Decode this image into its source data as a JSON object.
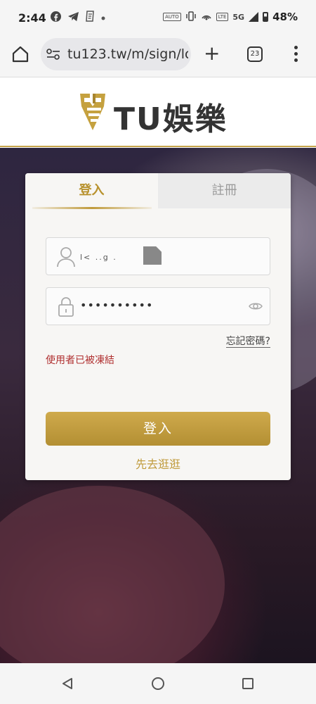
{
  "status_bar": {
    "time": "2:44",
    "network": "5G",
    "battery": "48%",
    "icons": [
      "facebook-icon",
      "telegram-icon",
      "receipt-icon",
      "dot-icon",
      "auto-icon",
      "vibrate-icon",
      "hotspot-icon",
      "volte-icon",
      "signal-icon",
      "battery-icon"
    ],
    "auto_label": "AUTO",
    "volte_label": "LTE"
  },
  "browser": {
    "url": "tu123.tw/m/sign/lc",
    "tab_count": "23"
  },
  "site": {
    "logo_text": "TU娛樂",
    "accent_color": "#c09b3c"
  },
  "login": {
    "tab_login": "登入",
    "tab_register": "註冊",
    "username_value": "l< ..g .",
    "password_value": "••••••••••",
    "forgot_password": "忘記密碼?",
    "error_message": "使用者已被凍結",
    "login_button": "登入",
    "browse_link": "先去逛逛",
    "error_color": "#b03030"
  }
}
